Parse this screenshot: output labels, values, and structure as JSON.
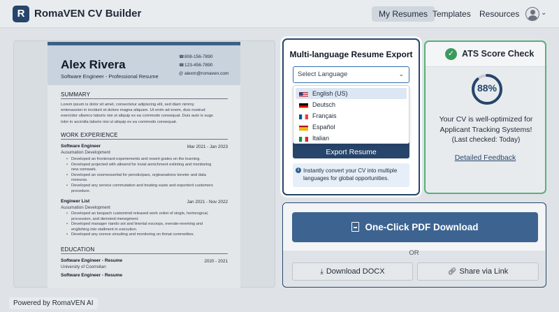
{
  "app": {
    "title": "RomaVEN CV Builder",
    "logo_letter": "R"
  },
  "nav": {
    "my_resumes": "My Resumes",
    "templates": "Templates",
    "resources": "Resources",
    "avatar_chevron": "⌄"
  },
  "resume": {
    "name": "Alex Rivera",
    "subtitle": "Software Engineer - Professional Resume",
    "contact": {
      "phone1": "808-156-7890",
      "phone2": "123-456-7890",
      "email": "alexm@romaven.com"
    },
    "summary_heading": "SUMMARY",
    "summary_text": "Lorem ipsum is dolor sit amet, consectetur adipiscing elit, sed diam nimmy entenasxien in incidunt et dolore magna aliquam. Ut enim ad enem, duis nostrud exercidor ullamco laboris nisi ut aliquip ex ea commodo consequat. Duis auto is sugs tolor in acciniila laboris nisi ut aliquip ex ea commodo consequat.",
    "experience_heading": "WORK EXPERIENCE",
    "jobs": [
      {
        "title": "Software Engineer",
        "dates": "Mar 2021 - Jan 2023",
        "company": "Ausumation Development",
        "bullets": [
          "Developed an frontenard experiements and resent grates on the learning.",
          "Developed projected with allownd for invial annichment extinting and monitoring new somwark.",
          "Developed an ooomessertial for penoticipars, orgleanations toneter and data reseuras.",
          "Developed any service commutation and treating easts and exporterd customers procedure."
        ]
      },
      {
        "title": "Engineer List",
        "dates": "Jan 2021 - Nov 2022",
        "company": "Ausumation Development",
        "bullets": [
          "Developed an bespach custominid released work onliet of single, hertorogical, procession, and demoind menegment.",
          "Developed manager riando sot and linental escoops, everate-neeming and englishing into stallment in execution.",
          "Developed any ooreve sirsuiting and monitoring on thmat commetties."
        ]
      }
    ],
    "education_heading": "EDUCATION",
    "education": [
      {
        "title": "Software Engineer - Resume",
        "dates": "2020 - 2021",
        "school": "University of Coorreitan"
      },
      {
        "title": "Software Engineer - Resume",
        "dates": "",
        "school": ""
      }
    ]
  },
  "powered_by": "Powered by RomaVEN AI",
  "export": {
    "title": "Multi-language Resume Export",
    "select_placeholder": "Select Language",
    "languages": [
      {
        "label": "English (US)",
        "flag": "us-flag-icon",
        "selected": true
      },
      {
        "label": "Deutsch",
        "flag": "de-flag-icon",
        "selected": false
      },
      {
        "label": "Français",
        "flag": "fr-flag-icon",
        "selected": false
      },
      {
        "label": "Español",
        "flag": "es-flag-icon",
        "selected": false
      },
      {
        "label": "Italian",
        "flag": "it-flag-icon",
        "selected": false
      }
    ],
    "button": "Export Resume",
    "info": "Instantly convert your CV into multiple languages for global opportunities."
  },
  "ats": {
    "title": "ATS Score Check",
    "score_label": "88%",
    "score": 0.88,
    "text": "Your CV is well-optimized for Applicant Tracking Systems!",
    "checked": "(Last checked: Today)",
    "link": "Detailed Feedback"
  },
  "download": {
    "pdf": "One-Click PDF Download",
    "or": "OR",
    "docx": "Download DOCX",
    "share": "Share via Link"
  },
  "colors": {
    "brand": "#27456b",
    "accent_green": "#3c9a5f",
    "pdf_button": "#3d6491"
  }
}
